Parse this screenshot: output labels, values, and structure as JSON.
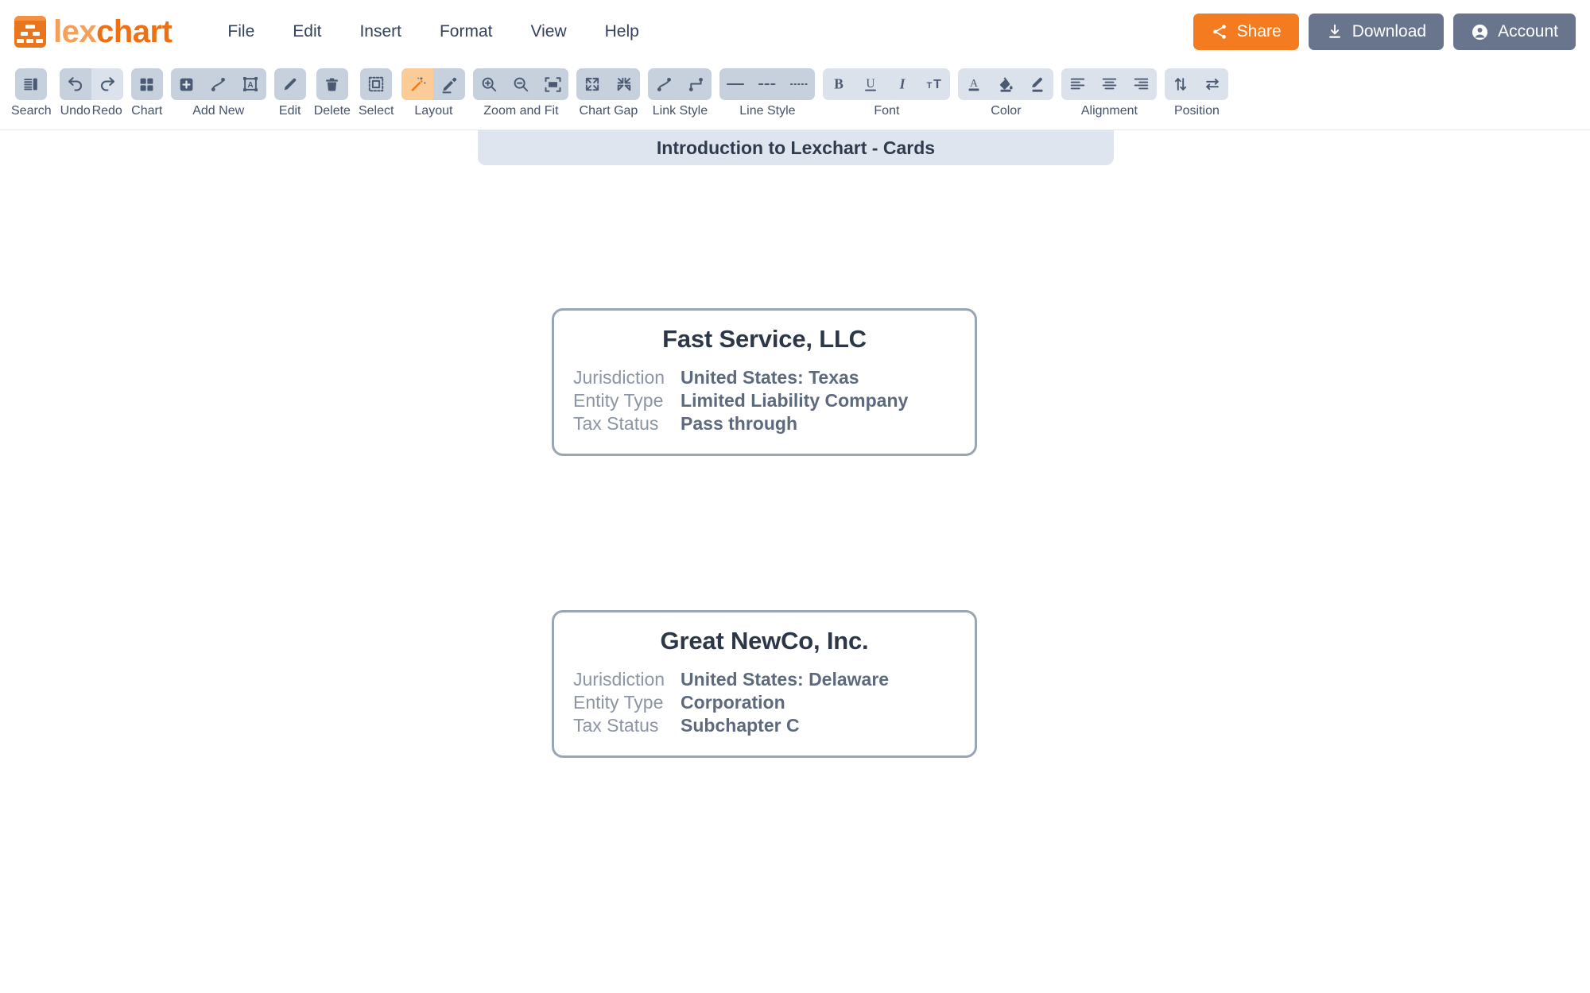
{
  "app": {
    "brand_prefix": "lex",
    "brand_suffix": "chart",
    "logo_icon": "lexchart-hierarchy-logo-icon",
    "accent_color": "#ed7014",
    "accent_light": "#f5a05a",
    "grey_button_color": "#68758c",
    "share_button_color": "#f47b20"
  },
  "menubar": {
    "items": [
      {
        "label": "File"
      },
      {
        "label": "Edit"
      },
      {
        "label": "Insert"
      },
      {
        "label": "Format"
      },
      {
        "label": "View"
      },
      {
        "label": "Help"
      }
    ]
  },
  "header_actions": {
    "share": {
      "label": "Share",
      "icon": "share-icon"
    },
    "download": {
      "label": "Download",
      "icon": "download-icon"
    },
    "account": {
      "label": "Account",
      "icon": "account-icon"
    }
  },
  "toolbar": {
    "groups": [
      {
        "label": "Search",
        "buttons": [
          {
            "icon": "search-panel-icon",
            "name": "search-button",
            "state": "normal"
          }
        ]
      },
      {
        "labels": [
          "Undo",
          "Redo"
        ],
        "buttons": [
          {
            "icon": "undo-arrow-icon",
            "name": "undo-button",
            "state": "normal"
          },
          {
            "icon": "redo-arrow-icon",
            "name": "redo-button",
            "state": "alt"
          }
        ]
      },
      {
        "label": "Chart",
        "buttons": [
          {
            "icon": "chart-grid-icon",
            "name": "chart-button",
            "state": "normal"
          }
        ]
      },
      {
        "label": "Add New",
        "buttons": [
          {
            "icon": "add-node-icon",
            "name": "add-node-button",
            "state": "normal"
          },
          {
            "icon": "add-link-icon",
            "name": "add-link-button",
            "state": "normal"
          },
          {
            "icon": "add-textbox-icon",
            "name": "add-textbox-button",
            "state": "normal"
          }
        ]
      },
      {
        "label": "Edit",
        "buttons": [
          {
            "icon": "pencil-icon",
            "name": "edit-button",
            "state": "normal"
          }
        ]
      },
      {
        "label": "Delete",
        "buttons": [
          {
            "icon": "trash-icon",
            "name": "delete-button",
            "state": "normal"
          }
        ]
      },
      {
        "label": "Select",
        "buttons": [
          {
            "icon": "marquee-select-icon",
            "name": "select-button",
            "state": "normal"
          }
        ]
      },
      {
        "label": "Layout",
        "buttons": [
          {
            "icon": "magic-wand-auto-layout-icon",
            "name": "auto-layout-button",
            "state": "active"
          },
          {
            "icon": "manual-layout-pen-icon",
            "name": "manual-layout-button",
            "state": "normal"
          }
        ]
      },
      {
        "label": "Zoom and Fit",
        "buttons": [
          {
            "icon": "zoom-in-icon",
            "name": "zoom-in-button",
            "state": "normal"
          },
          {
            "icon": "zoom-out-icon",
            "name": "zoom-out-button",
            "state": "normal"
          },
          {
            "icon": "fit-to-screen-icon",
            "name": "fit-to-screen-button",
            "state": "normal"
          }
        ]
      },
      {
        "label": "Chart Gap",
        "buttons": [
          {
            "icon": "expand-gap-icon",
            "name": "increase-gap-button",
            "state": "normal"
          },
          {
            "icon": "contract-gap-icon",
            "name": "decrease-gap-button",
            "state": "normal"
          }
        ]
      },
      {
        "label": "Link Style",
        "buttons": [
          {
            "icon": "curved-link-icon",
            "name": "curved-link-button",
            "state": "normal"
          },
          {
            "icon": "elbow-link-icon",
            "name": "elbow-link-button",
            "state": "normal"
          }
        ]
      },
      {
        "label": "Line Style",
        "buttons": [
          {
            "icon": "solid-line-icon",
            "name": "solid-line-button",
            "state": "normal"
          },
          {
            "icon": "dashed-line-icon",
            "name": "dashed-line-button",
            "state": "normal"
          },
          {
            "icon": "dotted-line-icon",
            "name": "dotted-line-button",
            "state": "normal"
          }
        ]
      },
      {
        "label": "Font",
        "buttons": [
          {
            "icon": "bold-icon",
            "name": "bold-button",
            "state": "normal"
          },
          {
            "icon": "underline-icon",
            "name": "underline-button",
            "state": "normal"
          },
          {
            "icon": "italic-icon",
            "name": "italic-button",
            "state": "normal"
          },
          {
            "icon": "font-size-icon",
            "name": "font-size-button",
            "state": "normal"
          }
        ]
      },
      {
        "label": "Color",
        "buttons": [
          {
            "icon": "text-color-icon",
            "name": "text-color-button",
            "state": "normal"
          },
          {
            "icon": "fill-color-icon",
            "name": "fill-color-button",
            "state": "normal"
          },
          {
            "icon": "line-color-icon",
            "name": "line-color-button",
            "state": "normal"
          }
        ]
      },
      {
        "label": "Alignment",
        "buttons": [
          {
            "icon": "align-left-icon",
            "name": "align-left-button",
            "state": "normal"
          },
          {
            "icon": "align-center-icon",
            "name": "align-center-button",
            "state": "normal"
          },
          {
            "icon": "align-right-icon",
            "name": "align-right-button",
            "state": "normal"
          }
        ]
      },
      {
        "label": "Position",
        "buttons": [
          {
            "icon": "swap-vertical-icon",
            "name": "swap-vertical-button",
            "state": "normal"
          },
          {
            "icon": "swap-horizontal-icon",
            "name": "swap-horizontal-button",
            "state": "normal"
          }
        ]
      }
    ]
  },
  "document": {
    "title": "Introduction to Lexchart - Cards"
  },
  "chart": {
    "cards": [
      {
        "title": "Fast Service, LLC",
        "rows": [
          {
            "key": "Jurisdiction",
            "value": "United States: Texas"
          },
          {
            "key": "Entity Type",
            "value": "Limited Liability Company"
          },
          {
            "key": "Tax Status",
            "value": "Pass through"
          }
        ]
      },
      {
        "title": "Great NewCo, Inc.",
        "rows": [
          {
            "key": "Jurisdiction",
            "value": "United States: Delaware"
          },
          {
            "key": "Entity Type",
            "value": "Corporation"
          },
          {
            "key": "Tax Status",
            "value": "Subchapter C"
          }
        ]
      }
    ]
  }
}
